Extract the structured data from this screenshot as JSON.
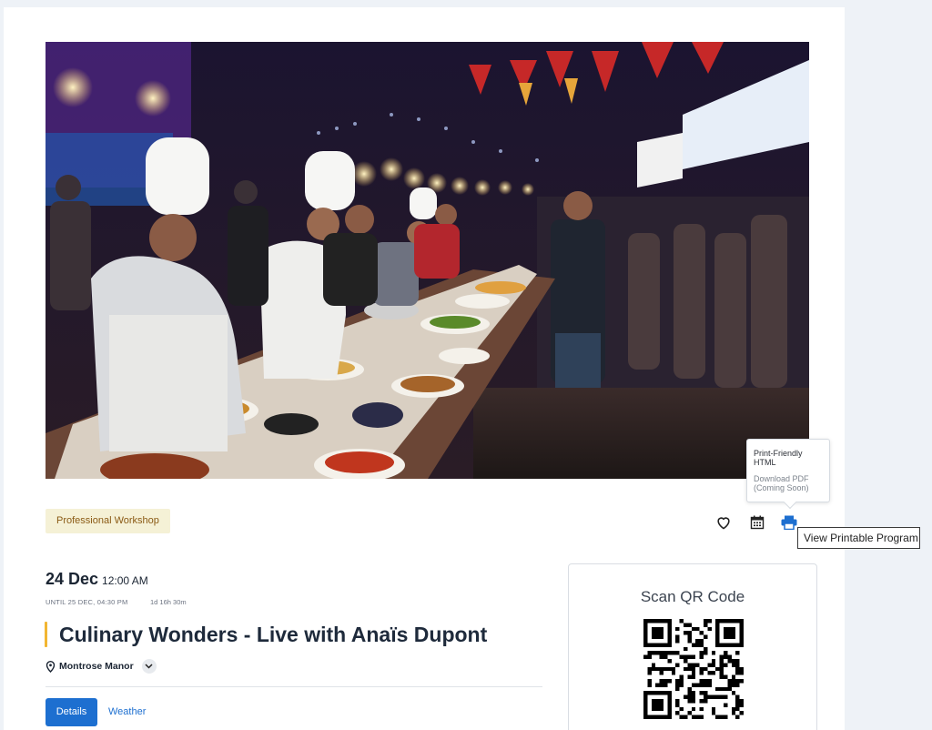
{
  "hero": {
    "alt_icon": "street-food-market-photo"
  },
  "tag": "Professional Workshop",
  "actions": {
    "favorite_icon": "heart-icon",
    "calendar_icon": "calendar-icon",
    "print_icon": "print-icon"
  },
  "print_menu": {
    "item1": "Print-Friendly HTML",
    "item2": "Download PDF (Coming Soon)"
  },
  "tooltip": "View Printable Program",
  "event": {
    "date": "24 Dec",
    "time": "12:00 AM",
    "until": "UNTIL 25 DEC, 04:30 PM",
    "duration": "1d 16h 30m",
    "title": "Culinary Wonders - Live with Anaïs Dupont",
    "location": "Montrose Manor"
  },
  "tabs": {
    "details": "Details",
    "weather": "Weather"
  },
  "qr": {
    "title": "Scan QR Code"
  },
  "colors": {
    "accent": "#1d6fd0",
    "title_bar": "#f2b632",
    "tag_bg": "#f5f1d6"
  }
}
